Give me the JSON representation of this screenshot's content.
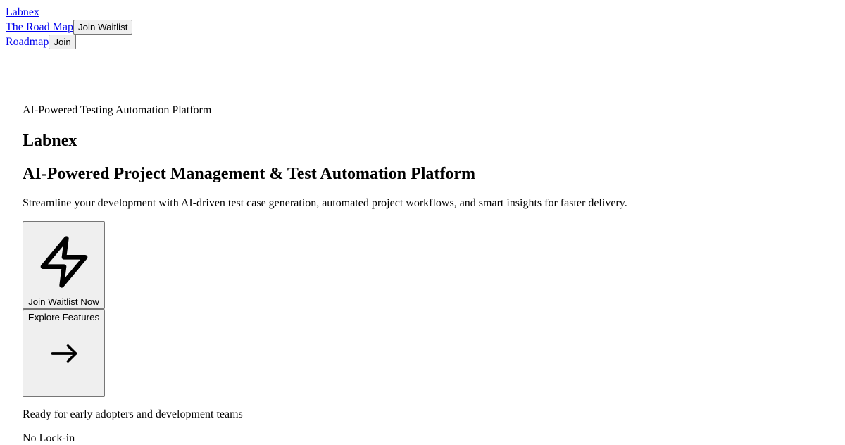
{
  "nav": {
    "brand_link": "Labnex",
    "roadmap_full_link": "The Road Map",
    "waitlist_button": "Join Waitlist",
    "roadmap_short_link": "Roadmap",
    "join_button": "Join"
  },
  "hero": {
    "eyebrow": "AI-Powered Testing Automation Platform",
    "brand": "Labnex",
    "headline": "AI-Powered Project Management & Test Automation Platform",
    "subtitle": "Streamline your development with AI-driven test case generation, automated project workflows, and smart insights for faster delivery.",
    "primary_cta": {
      "label": "Join Waitlist Now",
      "icon": "lightning-bolt-icon"
    },
    "secondary_cta": {
      "label": "Explore Features",
      "icon": "arrow-right-icon"
    },
    "note": "Ready for early adopters and development teams",
    "feature_tag": "No Lock-in"
  }
}
